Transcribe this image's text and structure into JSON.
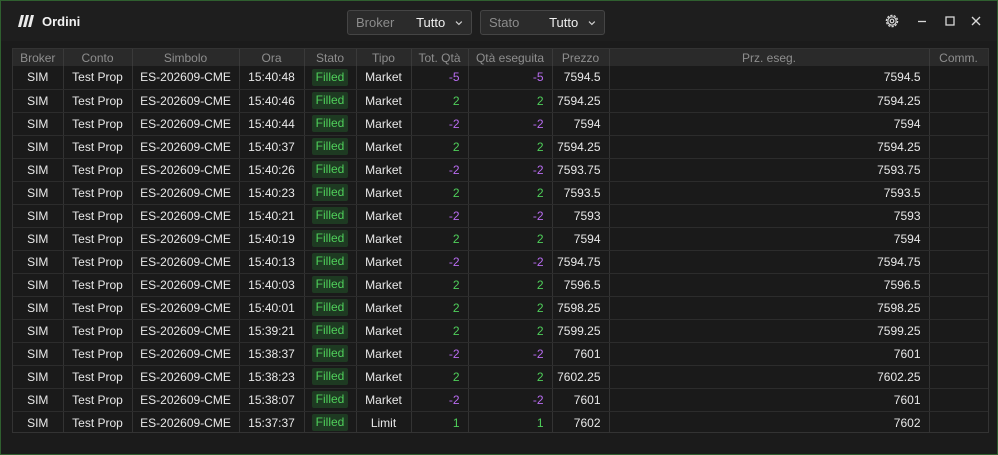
{
  "window": {
    "title": "Ordini"
  },
  "filters": {
    "broker": {
      "label": "Broker",
      "value": "Tutto"
    },
    "stato": {
      "label": "Stato",
      "value": "Tutto"
    }
  },
  "colors": {
    "accent_positive": "#4fcf5a",
    "accent_negative": "#b86cf0",
    "border": "#2f5f2f"
  },
  "table": {
    "columns": [
      "Broker",
      "Conto",
      "Simbolo",
      "Ora",
      "Stato",
      "Tipo",
      "Tot. Qtà",
      "Qtà eseguita",
      "Prezzo",
      "Prz. eseg.",
      "Comm."
    ],
    "rows": [
      [
        "SIM",
        "Test Prop",
        "ES-202609-CME",
        "15:40:48",
        "Filled",
        "Market",
        "-5",
        "-5",
        "7594.5",
        "7594.5",
        ""
      ],
      [
        "SIM",
        "Test Prop",
        "ES-202609-CME",
        "15:40:46",
        "Filled",
        "Market",
        "2",
        "2",
        "7594.25",
        "7594.25",
        ""
      ],
      [
        "SIM",
        "Test Prop",
        "ES-202609-CME",
        "15:40:44",
        "Filled",
        "Market",
        "-2",
        "-2",
        "7594",
        "7594",
        ""
      ],
      [
        "SIM",
        "Test Prop",
        "ES-202609-CME",
        "15:40:37",
        "Filled",
        "Market",
        "2",
        "2",
        "7594.25",
        "7594.25",
        ""
      ],
      [
        "SIM",
        "Test Prop",
        "ES-202609-CME",
        "15:40:26",
        "Filled",
        "Market",
        "-2",
        "-2",
        "7593.75",
        "7593.75",
        ""
      ],
      [
        "SIM",
        "Test Prop",
        "ES-202609-CME",
        "15:40:23",
        "Filled",
        "Market",
        "2",
        "2",
        "7593.5",
        "7593.5",
        ""
      ],
      [
        "SIM",
        "Test Prop",
        "ES-202609-CME",
        "15:40:21",
        "Filled",
        "Market",
        "-2",
        "-2",
        "7593",
        "7593",
        ""
      ],
      [
        "SIM",
        "Test Prop",
        "ES-202609-CME",
        "15:40:19",
        "Filled",
        "Market",
        "2",
        "2",
        "7594",
        "7594",
        ""
      ],
      [
        "SIM",
        "Test Prop",
        "ES-202609-CME",
        "15:40:13",
        "Filled",
        "Market",
        "-2",
        "-2",
        "7594.75",
        "7594.75",
        ""
      ],
      [
        "SIM",
        "Test Prop",
        "ES-202609-CME",
        "15:40:03",
        "Filled",
        "Market",
        "2",
        "2",
        "7596.5",
        "7596.5",
        ""
      ],
      [
        "SIM",
        "Test Prop",
        "ES-202609-CME",
        "15:40:01",
        "Filled",
        "Market",
        "2",
        "2",
        "7598.25",
        "7598.25",
        ""
      ],
      [
        "SIM",
        "Test Prop",
        "ES-202609-CME",
        "15:39:21",
        "Filled",
        "Market",
        "2",
        "2",
        "7599.25",
        "7599.25",
        ""
      ],
      [
        "SIM",
        "Test Prop",
        "ES-202609-CME",
        "15:38:37",
        "Filled",
        "Market",
        "-2",
        "-2",
        "7601",
        "7601",
        ""
      ],
      [
        "SIM",
        "Test Prop",
        "ES-202609-CME",
        "15:38:23",
        "Filled",
        "Market",
        "2",
        "2",
        "7602.25",
        "7602.25",
        ""
      ],
      [
        "SIM",
        "Test Prop",
        "ES-202609-CME",
        "15:38:07",
        "Filled",
        "Market",
        "-2",
        "-2",
        "7601",
        "7601",
        ""
      ],
      [
        "SIM",
        "Test Prop",
        "ES-202609-CME",
        "15:37:37",
        "Filled",
        "Limit",
        "1",
        "1",
        "7602",
        "7602",
        ""
      ]
    ]
  }
}
